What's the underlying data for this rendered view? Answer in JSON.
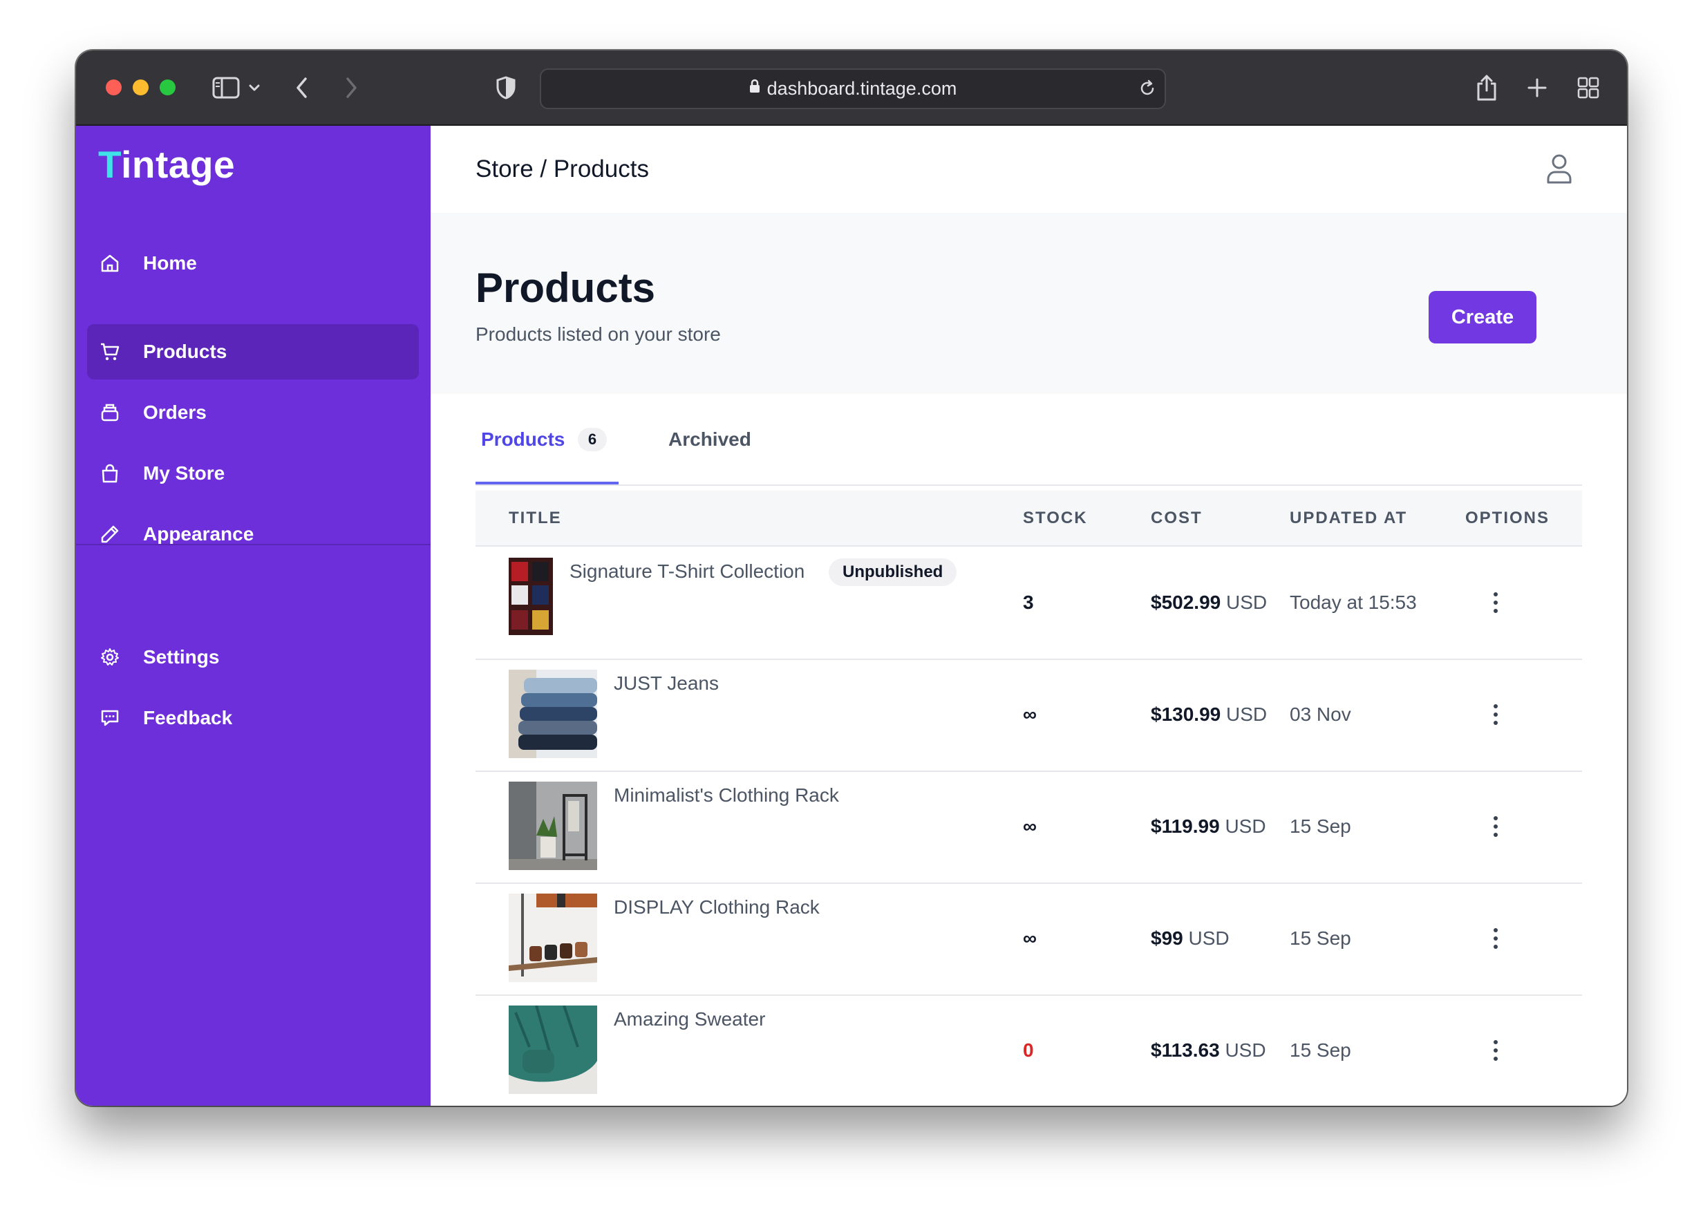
{
  "browser": {
    "url": "dashboard.tintage.com"
  },
  "sidebar": {
    "brand": "Tintage",
    "brand_first": "T",
    "brand_rest": "intage",
    "items": [
      {
        "label": "Home",
        "icon": "home-icon",
        "active": false
      },
      {
        "label": "Products",
        "icon": "cart-icon",
        "active": true
      },
      {
        "label": "Orders",
        "icon": "orders-icon",
        "active": false
      },
      {
        "label": "My Store",
        "icon": "bag-icon",
        "active": false
      },
      {
        "label": "Appearance",
        "icon": "pencil-icon",
        "active": false
      }
    ],
    "bottom_items": [
      {
        "label": "Settings",
        "icon": "gear-icon"
      },
      {
        "label": "Feedback",
        "icon": "chat-icon"
      }
    ]
  },
  "topbar": {
    "breadcrumb": "Store / Products"
  },
  "hero": {
    "title": "Products",
    "subtitle": "Products listed on your store",
    "create_label": "Create"
  },
  "tabs": [
    {
      "label": "Products",
      "count": "6",
      "active": true
    },
    {
      "label": "Archived",
      "active": false
    }
  ],
  "table": {
    "columns": [
      "TITLE",
      "STOCK",
      "COST",
      "UPDATED AT",
      "OPTIONS"
    ],
    "rows": [
      {
        "title": "Signature T-Shirt Collection",
        "badge": "Unpublished",
        "stock": "3",
        "amount": "$502.99",
        "currency": "USD",
        "updated": "Today at 15:53"
      },
      {
        "title": "JUST Jeans",
        "stock": "∞",
        "amount": "$130.99",
        "currency": "USD",
        "updated": "03 Nov"
      },
      {
        "title": "Minimalist's Clothing Rack",
        "stock": "∞",
        "amount": "$119.99",
        "currency": "USD",
        "updated": "15 Sep"
      },
      {
        "title": "DISPLAY Clothing Rack",
        "stock": "∞",
        "amount": "$99",
        "currency": "USD",
        "updated": "15 Sep"
      },
      {
        "title": "Amazing Sweater",
        "stock": "0",
        "amount": "$113.63",
        "currency": "USD",
        "updated": "15 Sep"
      }
    ]
  },
  "colors": {
    "sidebar": "#6d2fd9",
    "sidebar_active": "#5a25b8",
    "brand_accent": "#3ee2e8",
    "primary_button": "#7239e3",
    "active_tab": "#4f46e5",
    "out_of_stock": "#dc2626"
  }
}
